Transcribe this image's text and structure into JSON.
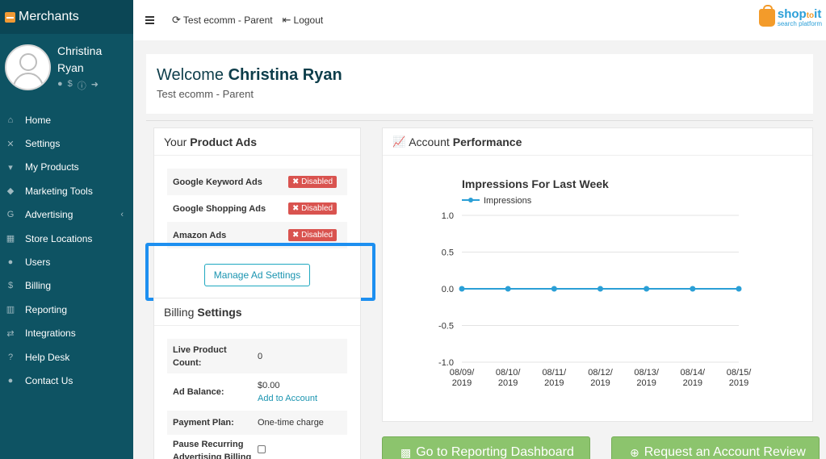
{
  "sidebar": {
    "brand": "Merchants",
    "user": {
      "name": "Christina Ryan"
    },
    "items": [
      {
        "label": "Home",
        "icon": "home-icon",
        "glyph": "⌂"
      },
      {
        "label": "Settings",
        "icon": "tools-icon",
        "glyph": "✕"
      },
      {
        "label": "My Products",
        "icon": "cart-icon",
        "glyph": "▾"
      },
      {
        "label": "Marketing Tools",
        "icon": "tag-icon",
        "glyph": "◆"
      },
      {
        "label": "Advertising",
        "icon": "google-icon",
        "glyph": "G"
      },
      {
        "label": "Store Locations",
        "icon": "store-icon",
        "glyph": "▦"
      },
      {
        "label": "Users",
        "icon": "users-icon",
        "glyph": "●"
      },
      {
        "label": "Billing",
        "icon": "dollar-icon",
        "glyph": "$"
      },
      {
        "label": "Reporting",
        "icon": "chart-icon",
        "glyph": "▥"
      },
      {
        "label": "Integrations",
        "icon": "exchange-icon",
        "glyph": "⇄"
      },
      {
        "label": "Help Desk",
        "icon": "question-icon",
        "glyph": "?"
      },
      {
        "label": "Contact Us",
        "icon": "chat-icon",
        "glyph": "●"
      }
    ]
  },
  "topbar": {
    "store_label": "Test ecomm - Parent",
    "logout_label": "Logout",
    "logo_word_a": "shop",
    "logo_word_b": "to",
    "logo_word_c": "it",
    "logo_sub": "search platform"
  },
  "welcome": {
    "greeting": "Welcome",
    "name": "Christina Ryan",
    "store": "Test ecomm - Parent"
  },
  "product_ads": {
    "title_a": "Your",
    "title_b": "Product Ads",
    "rows": [
      {
        "name": "Google Keyword Ads",
        "status": "Disabled"
      },
      {
        "name": "Google Shopping Ads",
        "status": "Disabled"
      },
      {
        "name": "Amazon Ads",
        "status": "Disabled"
      }
    ],
    "manage_label": "Manage Ad Settings"
  },
  "billing": {
    "title_a": "Billing",
    "title_b": "Settings",
    "live_count_label": "Live Product Count:",
    "live_count_value": "0",
    "ad_balance_label": "Ad Balance:",
    "ad_balance_value": "$0.00",
    "add_account_label": "Add to Account",
    "payment_plan_label": "Payment Plan:",
    "payment_plan_value": "One-time charge",
    "pause_label": "Pause Recurring Advertising Billing"
  },
  "performance": {
    "title_a": "Account",
    "title_b": "Performance"
  },
  "buttons": {
    "reporting": "Go to Reporting Dashboard",
    "review": "Request an Account Review"
  },
  "colors": {
    "sidebar": "#0e5363",
    "accent": "#1a94b0",
    "disabled": "#d9534f",
    "line": "#2a9fd6",
    "button": "#8cc46d"
  },
  "chart_data": {
    "type": "line",
    "title": "Impressions For Last Week",
    "x": [
      "08/09/ 2019",
      "08/10/ 2019",
      "08/11/ 2019",
      "08/12/ 2019",
      "08/13/ 2019",
      "08/14/ 2019",
      "08/15/ 2019"
    ],
    "series": [
      {
        "name": "Impressions",
        "values": [
          0,
          0,
          0,
          0,
          0,
          0,
          0
        ]
      }
    ],
    "ylim": [
      -1.0,
      1.0
    ],
    "yticks": [
      "1.0",
      "0.5",
      "0.0",
      "-0.5",
      "-1.0"
    ],
    "legend": "top-left",
    "grid": true
  }
}
